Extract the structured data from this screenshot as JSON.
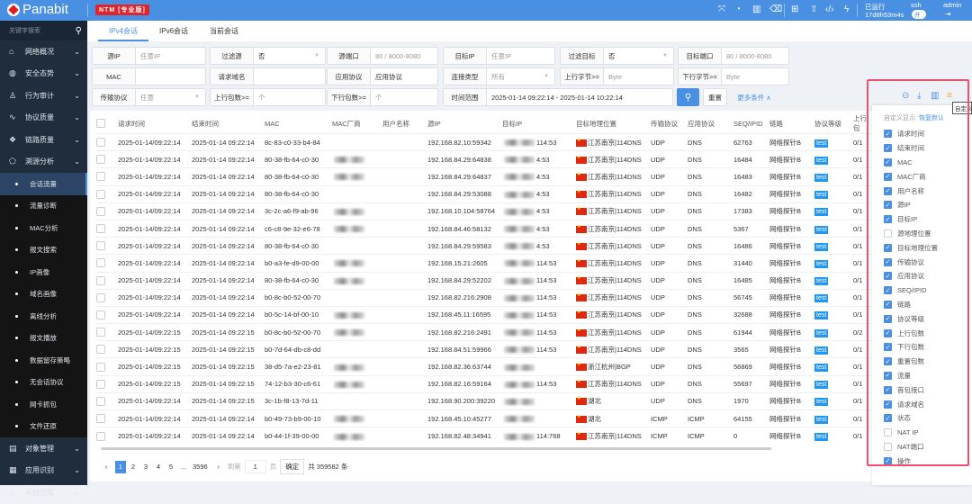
{
  "header": {
    "brand": "Panabit",
    "edition": "NTM [专业版]",
    "uptime_label": "已运行",
    "uptime": "17d8h53m4s",
    "ssh_label": "ssh",
    "ssh_toggle": "开",
    "user": "admin",
    "icons": [
      "fullscreen-icon",
      "dashboard-icon",
      "book-icon",
      "clean-icon",
      "layout-icon",
      "upload-icon",
      "code-icon",
      "flash-icon"
    ]
  },
  "sidebar": {
    "search_placeholder": "关键字搜索",
    "top": [
      {
        "label": "网络概况",
        "icon": "⌂"
      },
      {
        "label": "安全态势",
        "icon": "◍"
      },
      {
        "label": "行为审计",
        "icon": "♙"
      },
      {
        "label": "协议质量",
        "icon": "∿"
      },
      {
        "label": "链路质量",
        "icon": "❖"
      },
      {
        "label": "溯源分析",
        "icon": "⬠"
      }
    ],
    "sub": [
      "会话流量",
      "流量诊断",
      "MAC分析",
      "报文搜索",
      "IP画像",
      "域名画像",
      "离线分析",
      "报文播放",
      "数据留存策略",
      "无会话协议",
      "网卡抓包",
      "文件还原"
    ],
    "bottom": [
      {
        "label": "对象管理",
        "icon": "▤"
      },
      {
        "label": "应用识别",
        "icon": "▦"
      },
      {
        "label": "系统告警",
        "icon": "⌂"
      }
    ]
  },
  "tabs": [
    "IPv4会话",
    "IPv6会话",
    "当前会话"
  ],
  "filters": {
    "src_ip": {
      "label": "源IP",
      "placeholder": "任意IP"
    },
    "filter_src": {
      "label": "过滤源",
      "value": "否"
    },
    "src_port": {
      "label": "源端口",
      "placeholder": "80 / 8000-8080"
    },
    "dst_ip": {
      "label": "目标IP",
      "placeholder": "任意IP"
    },
    "filter_dst": {
      "label": "过滤目标",
      "value": "否"
    },
    "dst_port": {
      "label": "目标端口",
      "placeholder": "80 / 8000-8080"
    },
    "mac": {
      "label": "MAC",
      "value": ""
    },
    "domain": {
      "label": "请求域名",
      "value": ""
    },
    "app": {
      "label": "应用协议",
      "value": "应用协议"
    },
    "conn_type": {
      "label": "连接类型",
      "value": "所有"
    },
    "up_bytes": {
      "label": "上行字节>=",
      "placeholder": "Byte"
    },
    "down_bytes": {
      "label": "下行字节>=",
      "placeholder": "Byte"
    },
    "transport": {
      "label": "传输协议",
      "value": "任意"
    },
    "up_pkts": {
      "label": "上行包数>=",
      "placeholder": "个"
    },
    "down_pkts": {
      "label": "下行包数>=",
      "placeholder": "个"
    },
    "time_range": {
      "label": "时间范围",
      "value": "2025-01-14 09:22:14 - 2025-01-14 10:22:14"
    },
    "reset": "重置",
    "more": "更多条件 ∧"
  },
  "table": {
    "columns": [
      "请求时间",
      "结束时间",
      "MAC",
      "MAC厂商",
      "用户名称",
      "源IP",
      "目标IP",
      "目标地理位置",
      "传输协议",
      "应用协议",
      "SEQ/IPID",
      "链路",
      "协议等级",
      "上行包"
    ],
    "rows": [
      [
        "2025-01-14/09:22:14",
        "2025-01-14 09:22:14",
        "8c-83-c0-33-b4-84",
        "192.168.82.10:59342",
        "114:53",
        "江苏南京|114DNS",
        "UDP",
        "DNS",
        "62763",
        "网络探针B",
        "test",
        "0/1"
      ],
      [
        "2025-01-14/09:22:14",
        "2025-01-14 09:22:14",
        "80-38-fb-64-c0-30",
        "192.168.84.29:64838",
        "4:53",
        "江苏南京|114DNS",
        "UDP",
        "DNS",
        "16484",
        "网络探针B",
        "test",
        "0/1"
      ],
      [
        "2025-01-14/09:22:14",
        "2025-01-14 09:22:14",
        "80-38-fb-64-c0-30",
        "192.168.84.29:64837",
        "4:53",
        "江苏南京|114DNS",
        "UDP",
        "DNS",
        "16483",
        "网络探针B",
        "test",
        "0/1"
      ],
      [
        "2025-01-14/09:22:14",
        "2025-01-14 09:22:14",
        "80-38-fb-64-c0-30",
        "192.168.84.29:53088",
        "4:53",
        "江苏南京|114DNS",
        "UDP",
        "DNS",
        "16482",
        "网络探针B",
        "test",
        "0/1"
      ],
      [
        "2025-01-14/09:22:14",
        "2025-01-14 09:22:14",
        "3c-2c-a6-f9-ab-96",
        "192.168.10.104:58764",
        "4:53",
        "江苏南京|114DNS",
        "UDP",
        "DNS",
        "17383",
        "网络探针B",
        "test",
        "0/1"
      ],
      [
        "2025-01-14/09:22:14",
        "2025-01-14 09:22:14",
        "c6-c8-9e-32-e6-78",
        "192.168.84.46:58132",
        "4:53",
        "江苏南京|114DNS",
        "UDP",
        "DNS",
        "5367",
        "网络探针B",
        "test",
        "0/1"
      ],
      [
        "2025-01-14/09:22:14",
        "2025-01-14 09:22:14",
        "80-38-fb-64-c0-30",
        "192.168.84.29:59583",
        "4:53",
        "江苏南京|114DNS",
        "UDP",
        "DNS",
        "16486",
        "网络探针B",
        "test",
        "0/1"
      ],
      [
        "2025-01-14/09:22:14",
        "2025-01-14 09:22:14",
        "b0-a3-fe-d9-00-00",
        "192.168.15.21:2605",
        "114:53",
        "江苏南京|114DNS",
        "UDP",
        "DNS",
        "31440",
        "网络探针B",
        "test",
        "0/1"
      ],
      [
        "2025-01-14/09:22:14",
        "2025-01-14 09:22:14",
        "80-38-fb-64-c0-30",
        "192.168.84.29:52202",
        "114:53",
        "江苏南京|114DNS",
        "UDP",
        "DNS",
        "16485",
        "网络探针B",
        "test",
        "0/1"
      ],
      [
        "2025-01-14/09:22:14",
        "2025-01-14 09:22:14",
        "b0-8c-b0-52-00-70",
        "192.168.82.216:2908",
        "114:53",
        "江苏南京|114DNS",
        "UDP",
        "DNS",
        "56745",
        "网络探针B",
        "test",
        "0/1"
      ],
      [
        "2025-01-14/09:22:14",
        "2025-01-14 09:22:14",
        "b0-5c-14-bf-00-10",
        "192.168.45.11:16595",
        "114:53",
        "江苏南京|114DNS",
        "UDP",
        "DNS",
        "32688",
        "网络探针B",
        "test",
        "0/1"
      ],
      [
        "2025-01-14/09:22:15",
        "2025-01-14 09:22:15",
        "b0-8c-b0-52-00-70",
        "192.168.82.216:2491",
        "114:53",
        "江苏南京|114DNS",
        "UDP",
        "DNS",
        "61944",
        "网络探针B",
        "test",
        "0/2"
      ],
      [
        "2025-01-14/09:22:15",
        "2025-01-14 09:22:15",
        "b0-7d-64-db-c8-dd",
        "192.168.84.51:59966",
        "114:53",
        "江苏南京|114DNS",
        "UDP",
        "DNS",
        "3565",
        "网络探针B",
        "test",
        "0/1"
      ],
      [
        "2025-01-14/09:22:15",
        "2025-01-14 09:22:15",
        "38-d5-7a-e2-23-81",
        "192.168.82.36:63744",
        "",
        "浙江杭州|BGP",
        "UDP",
        "DNS",
        "56869",
        "网络探针B",
        "test",
        "0/1"
      ],
      [
        "2025-01-14/09:22:15",
        "2025-01-14 09:22:15",
        "74-12-b3-30-c6-61",
        "192.168.82.16:59164",
        "114:53",
        "江苏南京|114DNS",
        "UDP",
        "DNS",
        "55697",
        "网络探针B",
        "test",
        "0/1"
      ],
      [
        "2025-01-14/09:22:14",
        "2025-01-14 09:22:15",
        "3c-1b-f8-13-7d-11",
        "192.168.90.200:39220",
        "",
        "湖北",
        "UDP",
        "DNS",
        "1970",
        "网络探针B",
        "test",
        "0/1"
      ],
      [
        "2025-01-14/09:22:14",
        "2025-01-14 09:22:14",
        "b0-49-73-b9-00-10",
        "192.168.45.10:45277",
        "",
        "湖北",
        "ICMP",
        "ICMP",
        "64155",
        "网络探针B",
        "test",
        "0/1"
      ],
      [
        "2025-01-14/09:22:14",
        "2025-01-14 09:22:14",
        "b0-44-1f-39-00-00",
        "192.168.82.48:34941",
        "114:768",
        "江苏南京|114DNS",
        "ICMP",
        "ICMP",
        "0",
        "网络探针B",
        "test",
        "0/1"
      ]
    ]
  },
  "pagination": {
    "pages": [
      "1",
      "2",
      "3",
      "4",
      "5",
      "...",
      "3596"
    ],
    "goto_label": "到第",
    "goto_value": "1",
    "page_unit": "页",
    "confirm": "确定",
    "total": "共 359582 条"
  },
  "column_panel": {
    "title": "自定义显示",
    "restore": "恢复默认",
    "tooltip": "自定义",
    "items": [
      {
        "label": "请求时间",
        "on": true
      },
      {
        "label": "结束时间",
        "on": true
      },
      {
        "label": "MAC",
        "on": true
      },
      {
        "label": "MAC厂商",
        "on": true
      },
      {
        "label": "用户名称",
        "on": true
      },
      {
        "label": "源IP",
        "on": true
      },
      {
        "label": "目标IP",
        "on": true
      },
      {
        "label": "源地理位置",
        "on": false
      },
      {
        "label": "目标地理位置",
        "on": true
      },
      {
        "label": "传输协议",
        "on": true
      },
      {
        "label": "应用协议",
        "on": true
      },
      {
        "label": "SEQ/IPID",
        "on": true
      },
      {
        "label": "链路",
        "on": true
      },
      {
        "label": "协议等级",
        "on": true
      },
      {
        "label": "上行包数",
        "on": true
      },
      {
        "label": "下行包数",
        "on": true
      },
      {
        "label": "重置包数",
        "on": true
      },
      {
        "label": "流量",
        "on": true
      },
      {
        "label": "首包接口",
        "on": true
      },
      {
        "label": "请求域名",
        "on": true
      },
      {
        "label": "状态",
        "on": true
      },
      {
        "label": "NAT IP",
        "on": false
      },
      {
        "label": "NAT端口",
        "on": false
      },
      {
        "label": "操作",
        "on": true
      }
    ]
  },
  "colors": {
    "header": "#4a90e2",
    "sidebar": "#1f2d3d",
    "highlight": "#f0506e",
    "tag": "#2196f3"
  }
}
